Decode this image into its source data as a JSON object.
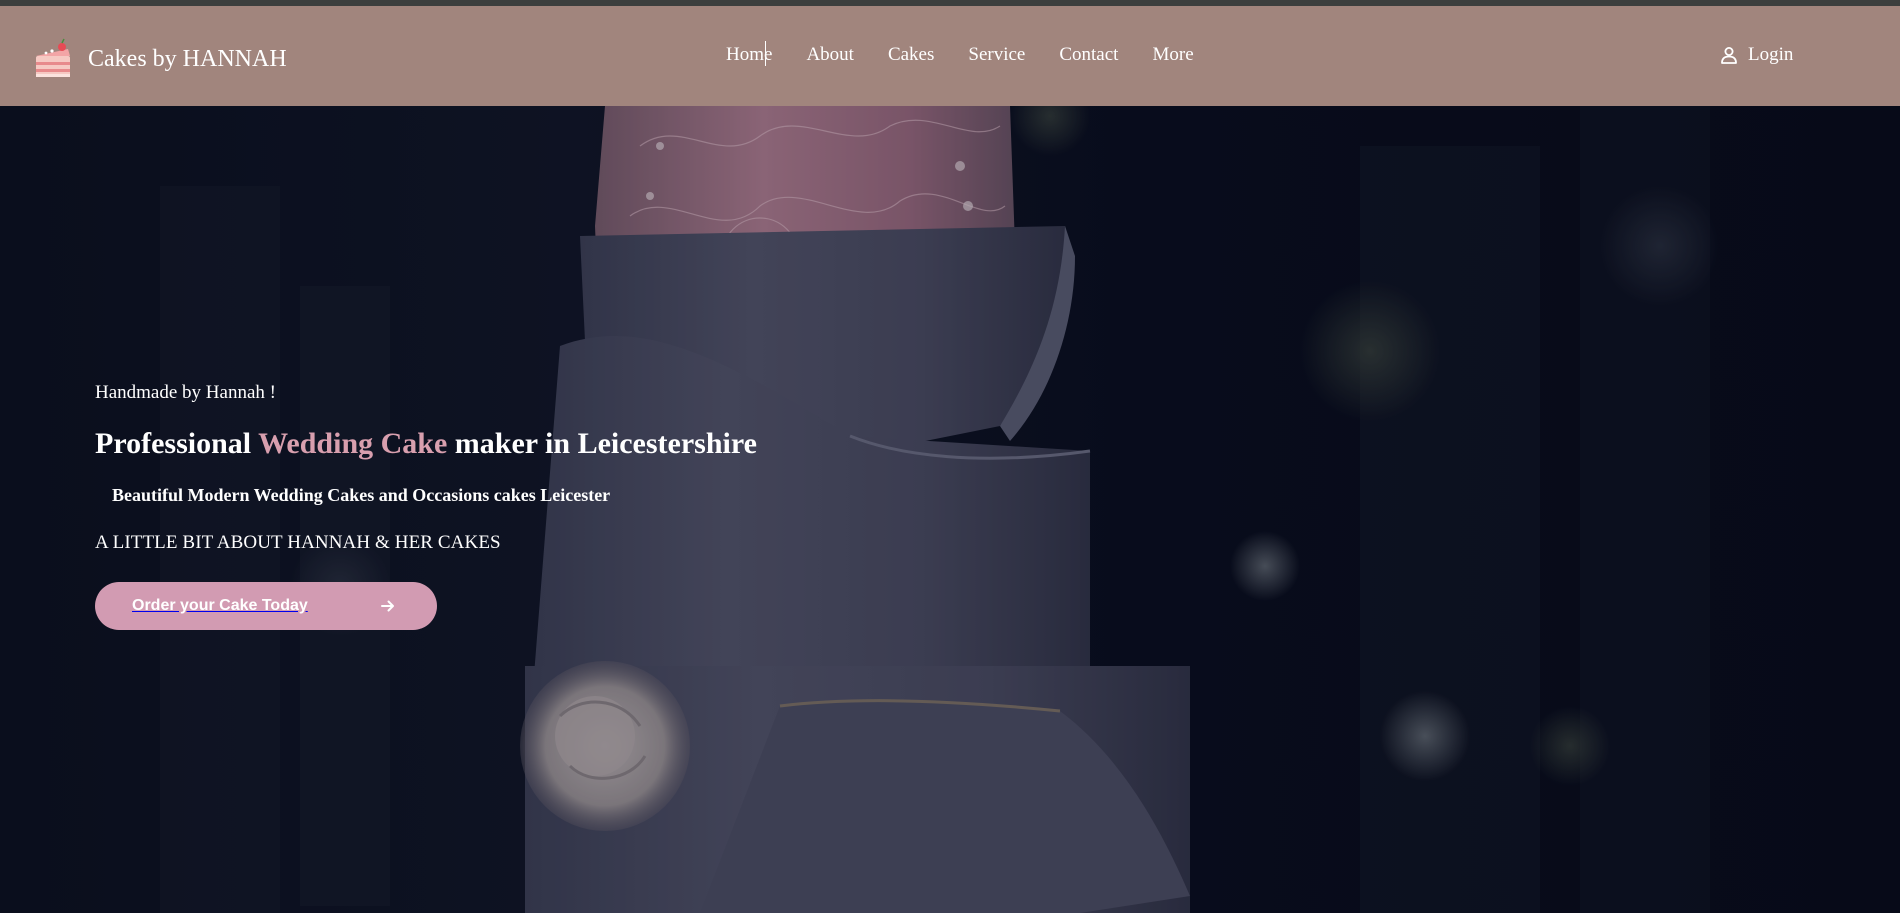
{
  "header": {
    "brand_name": "Cakes by HANNAH",
    "brand_icon": "cake-slice-icon",
    "nav": [
      {
        "label": "Home"
      },
      {
        "label": "About"
      },
      {
        "label": "Cakes"
      },
      {
        "label": "Service"
      },
      {
        "label": "Contact"
      },
      {
        "label": "More"
      }
    ],
    "login_label": "Login",
    "login_icon": "user-icon"
  },
  "hero": {
    "eyebrow": "Handmade by Hannah !",
    "headline_before": "Professional ",
    "headline_accent": "Wedding Cake",
    "headline_after": " maker in Leicestershire",
    "subhead": "Beautiful Modern Wedding Cakes and Occasions cakes Leicester",
    "about_line": "A LITTLE BIT ABOUT HANNAH & HER CAKES",
    "cta_label": "Order your Cake Today",
    "cta_icon": "arrow-right-icon"
  },
  "colors": {
    "top_strip": "#3c3f3e",
    "header_bg": "#a1857d",
    "hero_bg": "#070b19",
    "accent_pink": "#d89fae",
    "cta_bg": "#d29bb2",
    "text": "#ffffff"
  }
}
